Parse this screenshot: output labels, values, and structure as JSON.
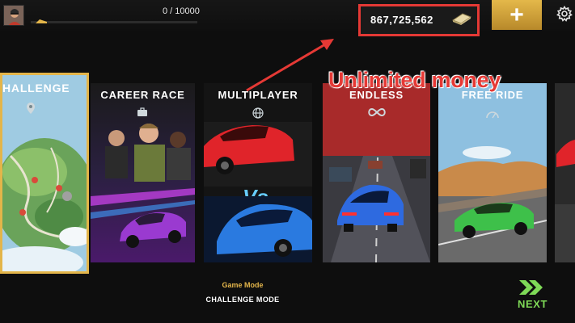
{
  "topbar": {
    "xp_text": "0 / 10000",
    "xp_progress": 0,
    "money": "867,725,562",
    "plus_label": "+"
  },
  "annotation": {
    "text": "Unlimited money",
    "color": "#e53935"
  },
  "cards": [
    {
      "title": "HALLENGE",
      "icon": "pin-icon",
      "selected": true
    },
    {
      "title": "CAREER RACE",
      "icon": "briefcase-icon"
    },
    {
      "title": "MULTIPLAYER",
      "icon": "globe-icon"
    },
    {
      "title": "ENDLESS",
      "icon": "infinity-icon"
    },
    {
      "title": "FREE RIDE",
      "icon": "speedometer-icon"
    }
  ],
  "footer": {
    "mode_label": "Game Mode",
    "mode_value": "CHALLENGE MODE",
    "next_label": "NEXT"
  },
  "colors": {
    "accent_gold": "#e3b54a",
    "next_green": "#7ed957"
  }
}
